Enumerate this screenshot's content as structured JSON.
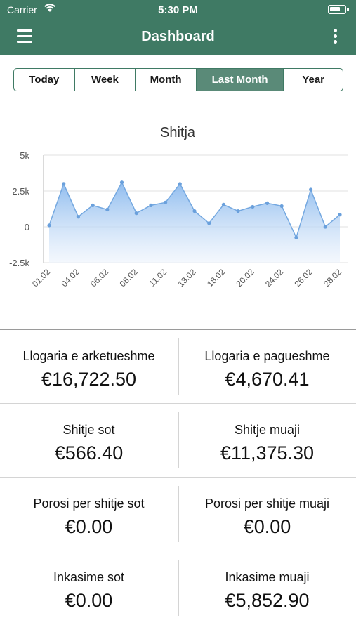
{
  "status_bar": {
    "carrier": "Carrier",
    "time": "5:30 PM"
  },
  "header": {
    "title": "Dashboard",
    "menu_icon": "hamburger-menu-icon",
    "more_icon": "vertical-ellipsis-icon"
  },
  "period_tabs": [
    {
      "label": "Today",
      "active": false
    },
    {
      "label": "Week",
      "active": false
    },
    {
      "label": "Month",
      "active": false
    },
    {
      "label": "Last Month",
      "active": true
    },
    {
      "label": "Year",
      "active": false
    }
  ],
  "chart_data": {
    "type": "area",
    "title": "Shitja",
    "x_tick_labels": [
      "01.02",
      "04.02",
      "06.02",
      "08.02",
      "11.02",
      "13.02",
      "18.02",
      "20.02",
      "24.02",
      "26.02",
      "28.02"
    ],
    "y_ticks": [
      {
        "value": 5000,
        "label": "5k"
      },
      {
        "value": 2500,
        "label": "2.5k"
      },
      {
        "value": 0,
        "label": "0"
      },
      {
        "value": -2500,
        "label": "-2.5k"
      }
    ],
    "ylim": [
      -2500,
      5000
    ],
    "series": [
      {
        "values": [
          100,
          3000,
          700,
          1500,
          1200,
          3100,
          950,
          1500,
          1700,
          3000,
          1100,
          250,
          1550,
          1100,
          1400,
          1650,
          1450,
          -750,
          2600,
          0,
          850
        ]
      }
    ],
    "grid": true,
    "colors": {
      "line": "#74a8e0",
      "marker": "#6aa0dc",
      "fill_top": "#8ab9ee",
      "fill_bottom": "#ecf3fc",
      "grid": "#e2e2e2",
      "axis": "#b5b5b5"
    }
  },
  "stats": [
    {
      "left": {
        "label": "Llogaria e arketueshme",
        "value": "€16,722.50"
      },
      "right": {
        "label": "Llogaria e pagueshme",
        "value": "€4,670.41"
      }
    },
    {
      "left": {
        "label": "Shitje sot",
        "value": "€566.40"
      },
      "right": {
        "label": "Shitje muaji",
        "value": "€11,375.30"
      }
    },
    {
      "left": {
        "label": "Porosi per shitje sot",
        "value": "€0.00"
      },
      "right": {
        "label": "Porosi per shitje muaji",
        "value": "€0.00"
      }
    },
    {
      "left": {
        "label": "Inkasime sot",
        "value": "€0.00"
      },
      "right": {
        "label": "Inkasime muaji",
        "value": "€5,852.90"
      }
    }
  ],
  "colors": {
    "brand": "#3f7a64",
    "active_tab": "#5a8a78"
  }
}
